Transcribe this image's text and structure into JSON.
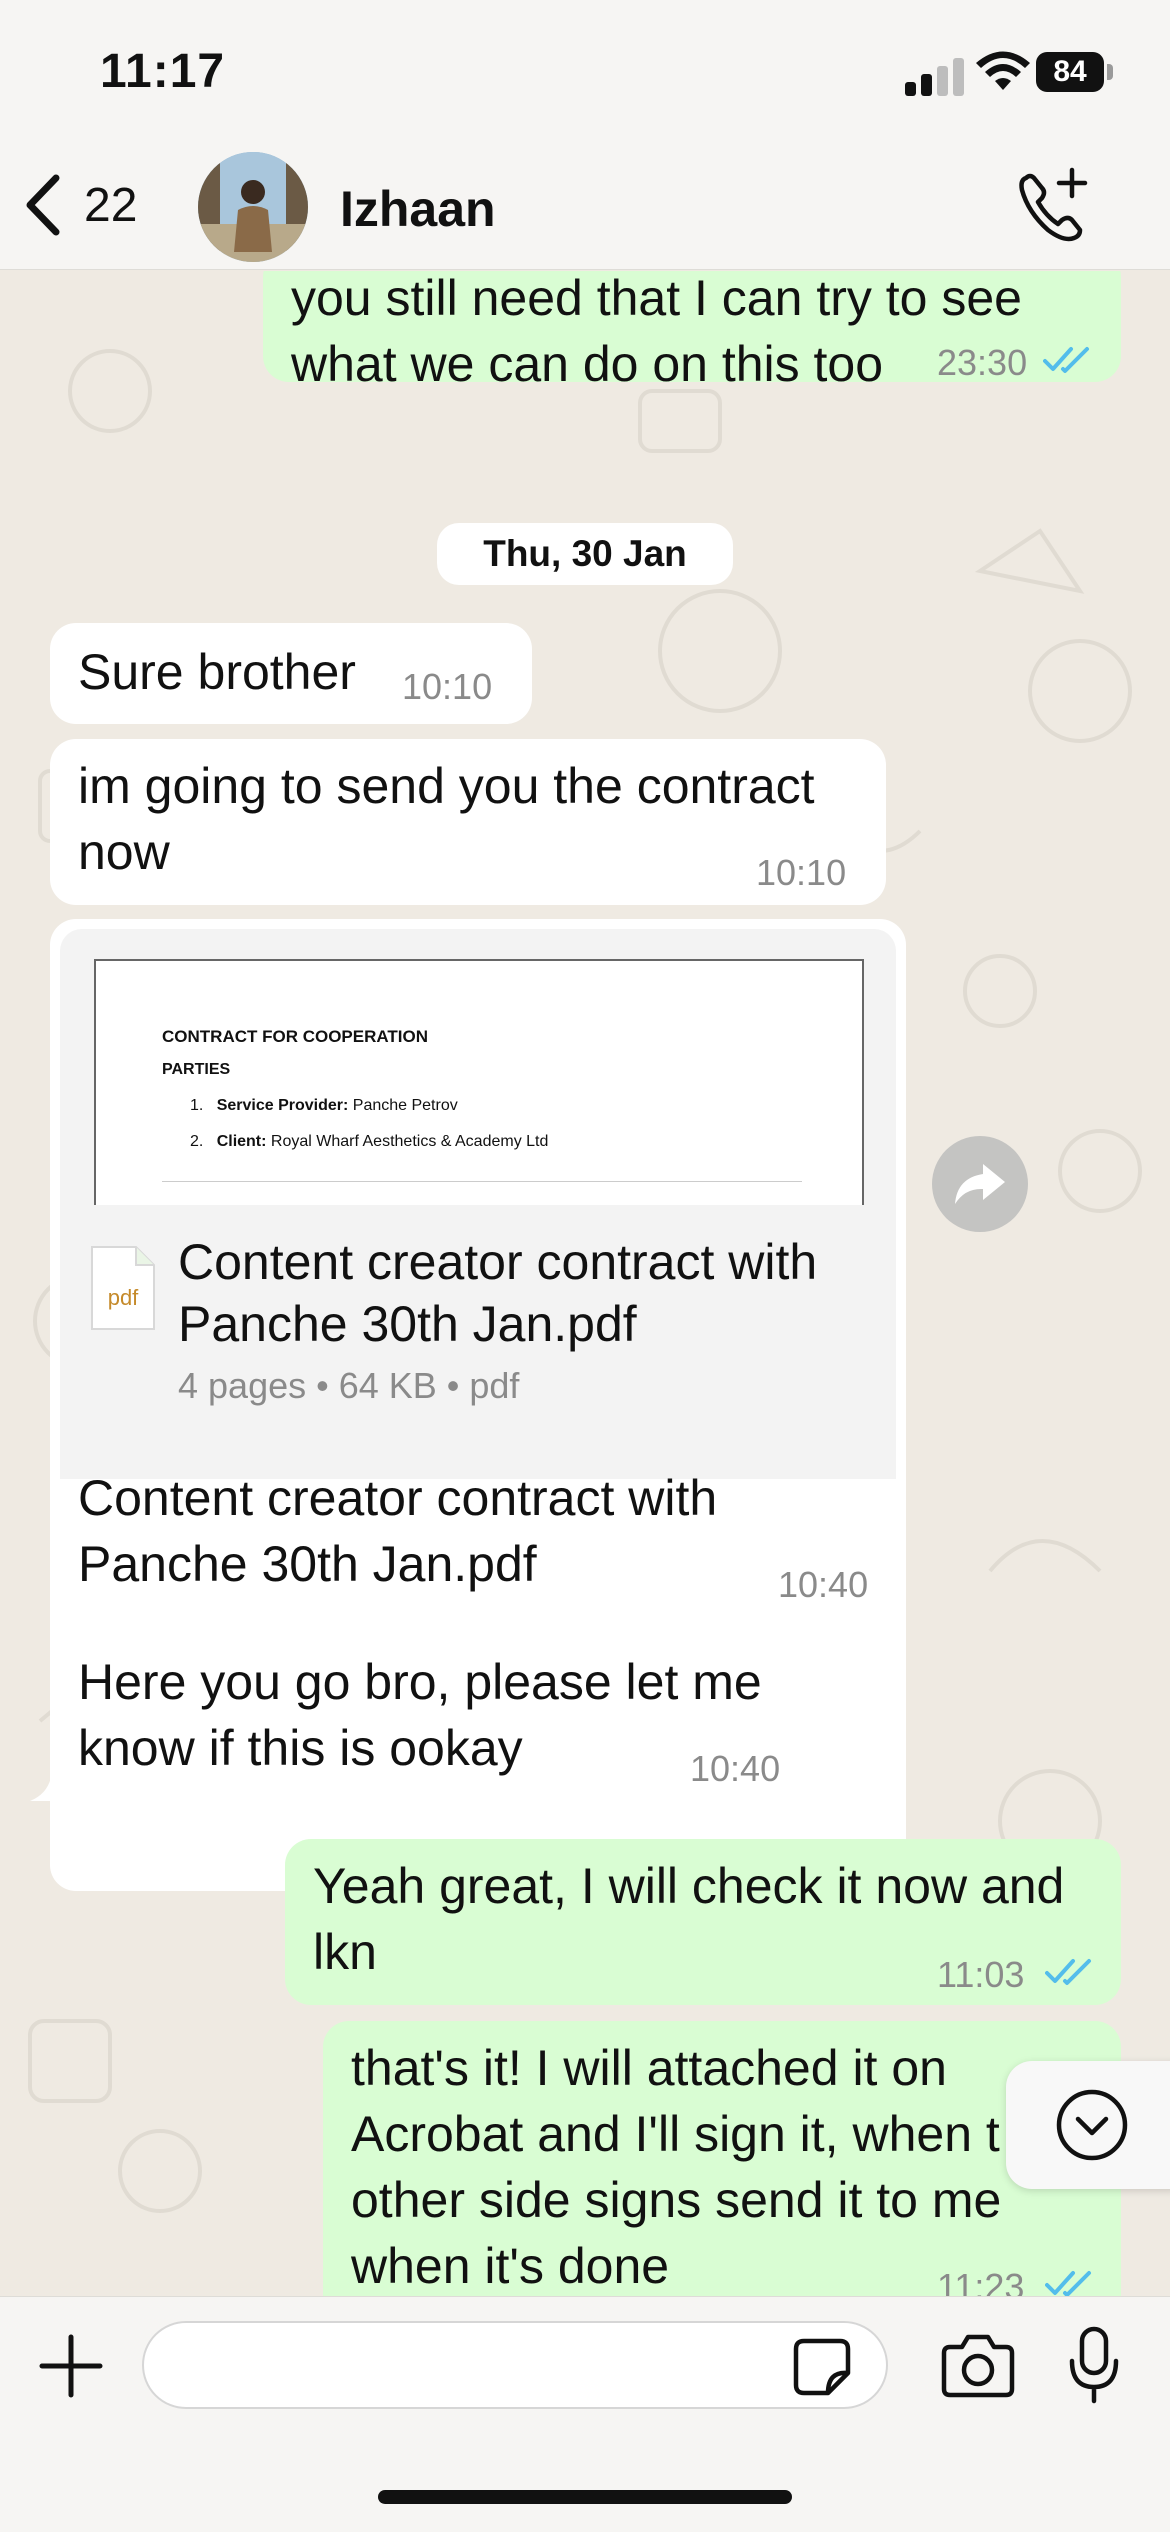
{
  "status_bar": {
    "time": "11:17",
    "battery": "84"
  },
  "header": {
    "back_count": "22",
    "contact_name": "Izhaan"
  },
  "messages": {
    "m1": {
      "line1": "you still need that I can try to see",
      "line2": "what we can do on this too",
      "time": "23:30"
    },
    "date": "Thu, 30 Jan",
    "m2": {
      "text": "Sure brother",
      "time": "10:10"
    },
    "m3": {
      "line1": "im going to send you the contract",
      "line2": "now",
      "time": "10:10"
    },
    "doc": {
      "preview_title": "CONTRACT FOR COOPERATION",
      "preview_parties": "PARTIES",
      "preview_item1_num": "1.",
      "preview_item1_label": "Service Provider:",
      "preview_item1_value": "Panche Petrov",
      "preview_item2_num": "2.",
      "preview_item2_label": "Client:",
      "preview_item2_value": "Royal Wharf Aesthetics & Academy Ltd",
      "file_icon_label": "pdf",
      "file_name_line1": "Content creator contract with",
      "file_name_line2": "Panche 30th Jan.pdf",
      "file_meta": "4 pages • 64 KB • pdf",
      "caption_line1": "Content creator contract with",
      "caption_line2": "Panche 30th Jan.pdf",
      "time": "10:40"
    },
    "m4": {
      "line1": "Here you go bro, please let me",
      "line2": "know if this is ookay",
      "time": "10:40"
    },
    "m5": {
      "line1": "Yeah great, I will check it now and",
      "line2": "lkn",
      "time": "11:03"
    },
    "m6": {
      "line1": "that's it! I will attached it on",
      "line2": "Acrobat and I'll sign it, when t",
      "line3": "other side signs send it to me",
      "line4": "when it's done",
      "time": "11:23"
    }
  },
  "input": {
    "placeholder": ""
  },
  "colors": {
    "outgoing_bubble": "#d9fdd3",
    "incoming_bubble": "#ffffff",
    "read_tick": "#53bdeb",
    "background": "#efeae2"
  },
  "icons": [
    "back-chevron-icon",
    "add-call-icon",
    "forward-icon",
    "chevron-down-icon",
    "plus-icon",
    "sticker-icon",
    "camera-icon",
    "microphone-icon",
    "pdf-file-icon"
  ]
}
